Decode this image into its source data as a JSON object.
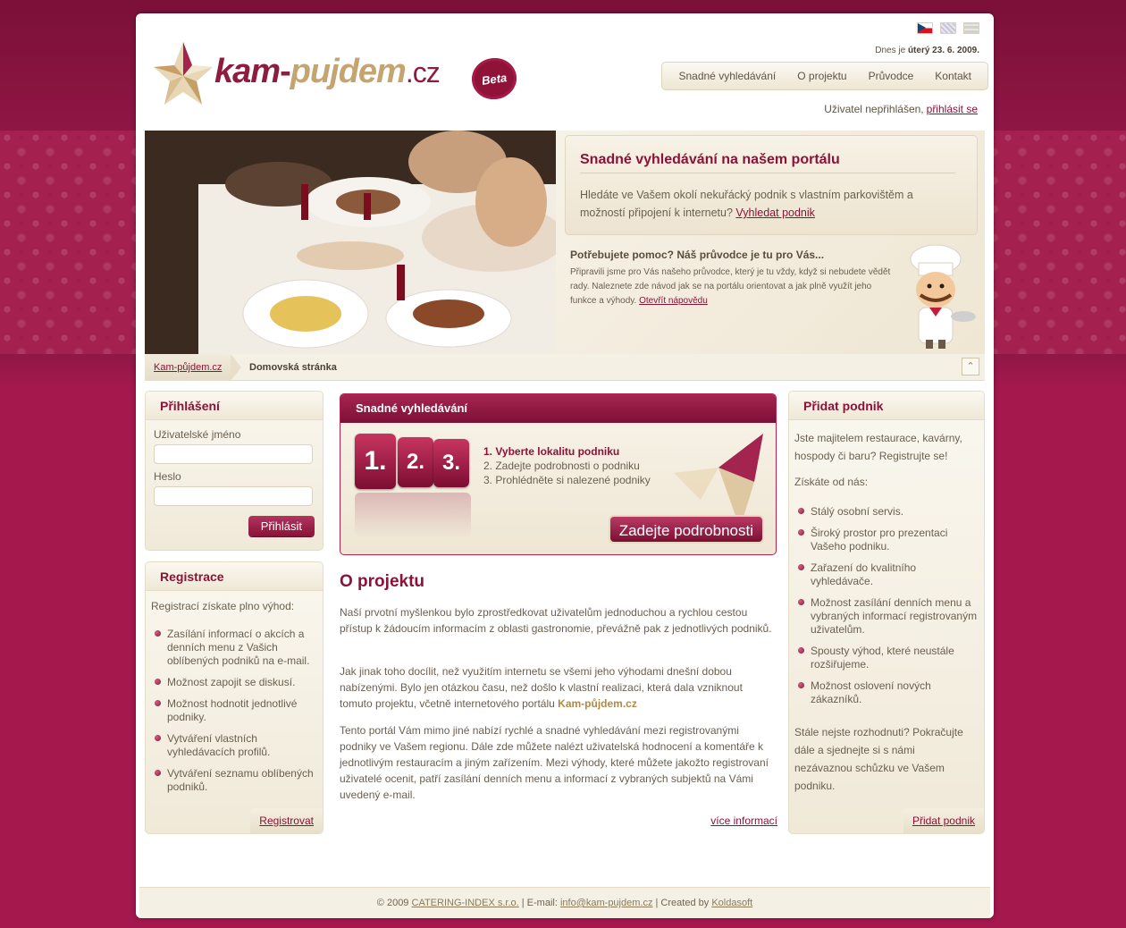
{
  "header": {
    "logo": {
      "kam": "kam",
      "dash": "-",
      "pujdem": "pujdem",
      "tld": ".cz",
      "badge": "Beta"
    },
    "languages": [
      "cz-flag-icon",
      "en-flag-icon",
      "de-flag-icon"
    ],
    "date_prefix": "Dnes je",
    "date_value": "úterý 23. 6. 2009.",
    "nav": [
      "Snadné vyhledávání",
      "O projektu",
      "Průvodce",
      "Kontakt"
    ],
    "user_status": "Uživatel nepřihlášen,",
    "login_link": "přihlásit se"
  },
  "hero": {
    "title": "Snadné vyhledávání na našem portálu",
    "text": "Hledáte ve Vašem okolí nekuřácký podnik s vlastním parkovištěm a možností připojení k internetu?",
    "text_link": "Vyhledat podnik",
    "help_title": "Potřebujete pomoc? Náš průvodce je tu pro Vás...",
    "help_text": "Připravili jsme pro Vás našeho průvodce, který je tu vždy, když si nebudete vědět rady. Naleznete zde návod jak se na portálu orientovat a jak plně využít jeho funkce a výhody.",
    "help_link": "Otevřít nápovědu"
  },
  "breadcrumb": {
    "home": "Kam-půjdem.cz",
    "current": "Domovská stránka"
  },
  "login": {
    "title": "Přihlášení",
    "username_label": "Uživatelské jméno",
    "password_label": "Heslo",
    "button": "Přihlásit"
  },
  "registration": {
    "title": "Registrace",
    "intro": "Registrací získate plno výhod:",
    "items": [
      "Zasílání informací o akcích a denních menu z Vašich oblíbených podniků na e-mail.",
      "Možnost zapojit se diskusí.",
      "Možnost hodnotit jednotlivé podniky.",
      "Vytváření vlastních vyhledávacích profilů.",
      "Vytváření seznamu oblíbených podniků."
    ],
    "link": "Registrovat"
  },
  "search": {
    "title": "Snadné vyhledávání",
    "graphic_steps": [
      "1.",
      "2.",
      "3."
    ],
    "steps": [
      "1. Vyberte lokalitu podniku",
      "2. Zadejte podrobnosti o podniku",
      "3. Prohlédněte si nalezené podniky"
    ],
    "button": "Zadejte podrobnosti"
  },
  "about": {
    "title": "O projektu",
    "p1": "Naší prvotní myšlenkou bylo zprostředkovat uživatelům jednoduchou a rychlou cestou přístup k žádoucím informacím z oblasti gastronomie, převážně pak z jednotlivých podniků.",
    "p2_before": "Jak jinak toho docílit, než využitím internetu se všemi jeho výhodami dnešní dobou nabízenými. Bylo jen otázkou času, než došlo k vlastní realizaci, která dala vzniknout tomuto projektu, včetně internetového portálu",
    "p2_brand": "Kam-půjdem.cz",
    "p3": "Tento portál Vám mimo jiné nabízí rychlé a snadné vyhledávání mezi registrovanými podniky ve Vašem regionu. Dále zde můžete nalézt uživatelská hodnocení a komentáře k jednotlivým restauracím a jiným zařízením. Mezi výhody, které můžete jakožto registrovaní uživatelé ocenit, patří zasílání denních menu a informací z vybraných subjektů na Vámi uvedený e-mail.",
    "more": "více informací"
  },
  "add_business": {
    "title": "Přidat podnik",
    "intro": "Jste majitelem restaurace, kavárny, hospody či baru? Registrujte se!",
    "subtitle": "Získáte od nás:",
    "items": [
      "Stálý osobní servis.",
      "Široký prostor pro prezentaci Vašeho podniku.",
      "Zařazení do kvalitního vyhledávače.",
      "Možnost zasílání denních menu a vybraných informací registrovaným uživatelům.",
      "Spousty výhod, které neustále rozšiřujeme.",
      "Možnost oslovení nových zákazníků."
    ],
    "outro": "Stále nejste rozhodnuti? Pokračujte dále a sjednejte si s námi nezávaznou schůzku ve Vašem podniku.",
    "link": "Přidat podnik"
  },
  "footer": {
    "copy": "© 2009",
    "company": "CATERING-INDEX s.r.o.",
    "email_label": "| E-mail:",
    "email": "info@kam-pujdem.cz",
    "created_label": "| Created by",
    "creator": "Koldasoft"
  }
}
